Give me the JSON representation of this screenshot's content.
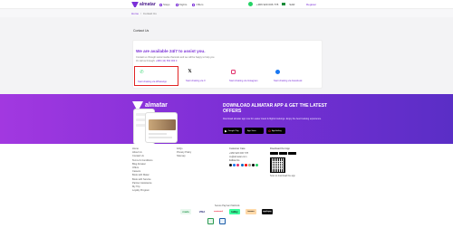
{
  "header": {
    "logo_text": "almatar",
    "nav": [
      {
        "label": "Stays",
        "icon": "bed-icon"
      },
      {
        "label": "Flights",
        "icon": "plane-icon"
      },
      {
        "label": "Offers",
        "icon": "tag-icon"
      }
    ],
    "phone": "+966 920 006 778",
    "currency": "SAR",
    "login": "Register"
  },
  "breadcrumb": {
    "home": "Home",
    "current": "Contact Us"
  },
  "page": {
    "title": "Contact Us",
    "heading": "We are available 24/7 to assist you.",
    "desc1": "Contact us through social media channels and we will be happy to help you.",
    "desc2_prefix": "Or call us through:",
    "desc2_phone": "+966 (12) 654 003 0"
  },
  "channels": [
    {
      "label": "Start chatting via WhatsApp",
      "icon": "whatsapp-icon"
    },
    {
      "label": "Start chatting via X",
      "icon": "x-icon"
    },
    {
      "label": "Start chatting via Instagram",
      "icon": "instagram-icon"
    },
    {
      "label": "Start chatting via Facebook",
      "icon": "facebook-icon"
    }
  ],
  "banner": {
    "logo_text": "almatar",
    "heading": "DOWNLOAD ALMATAR APP & GET THE LATEST OFFERS",
    "desc": "Download almatar app now for easier travel & flights bookings. Enjoy the best booking experience.",
    "stores": [
      "Google Play",
      "App Store",
      "AppGallery"
    ]
  },
  "footer": {
    "col1": [
      "Home",
      "About Us",
      "Contact Us",
      "Terms & Conditions",
      "Blog Almatar",
      "Offers",
      "Careers",
      "Book with Matar",
      "Book with Service",
      "Partner Assistance",
      "My Trip",
      "Loyalty Program"
    ],
    "col2": [
      "FAQs",
      "Privacy Policy",
      "Sitemap"
    ],
    "col3_title": "Customer Care",
    "col3_phone": "+966 920 006 778",
    "col3_email": "cs@almatar.com",
    "col3_follow": "Follow Us",
    "col4_title": "Download Our App",
    "qr_caption": "Scan to download the app"
  },
  "payments": {
    "label": "Secure Payment Methods",
    "methods": [
      "mada",
      "VISA",
      "mastercard",
      "tabby",
      "tamara",
      "applepay"
    ],
    "cert_caption": "Certified by"
  }
}
